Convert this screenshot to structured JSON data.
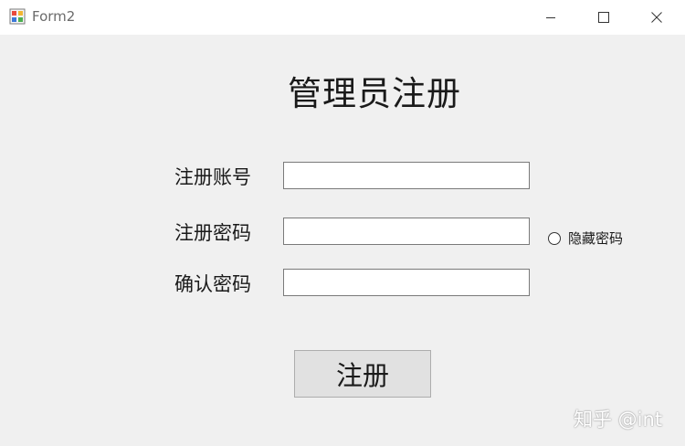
{
  "window": {
    "title": "Form2",
    "icons": {
      "app": "form-app-icon",
      "minimize": "minimize-icon",
      "maximize": "maximize-icon",
      "close": "close-icon"
    }
  },
  "form": {
    "heading": "管理员注册",
    "account_label": "注册账号",
    "account_value": "",
    "password_label": "注册密码",
    "password_value": "",
    "confirm_label": "确认密码",
    "confirm_value": "",
    "hide_password_label": "隐藏密码",
    "hide_password_checked": false,
    "register_button_label": "注册"
  },
  "watermark": {
    "text": "知乎 @int"
  },
  "colors": {
    "background": "#f0f0f0",
    "titlebar": "#ffffff",
    "button": "#e1e1e1",
    "border": "#7a7a7a"
  }
}
